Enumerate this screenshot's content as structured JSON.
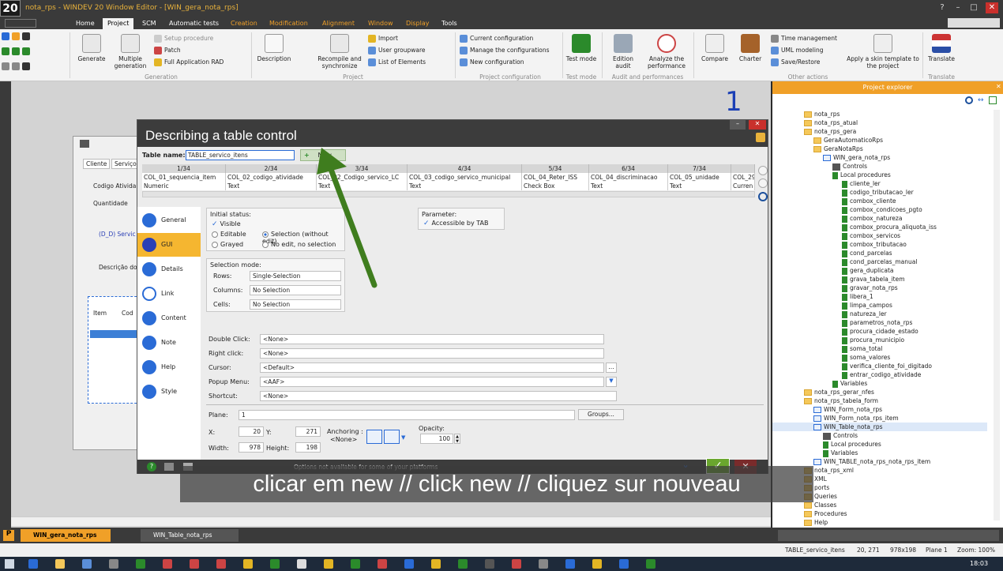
{
  "window": {
    "logo": "20",
    "title": "nota_rps - WINDEV 20  Window Editor - [WIN_gera_nota_rps]"
  },
  "menu": [
    "Home",
    "Project",
    "SCM",
    "Automatic tests",
    "Creation",
    "Modification",
    "Alignment",
    "Window",
    "Display",
    "Tools"
  ],
  "ribbon": {
    "generation": {
      "label": "Generation",
      "generate": "Generate",
      "multiple": "Multiple generation",
      "setup": "Setup procedure",
      "patch": "Patch",
      "full": "Full Application RAD"
    },
    "project": {
      "label": "Project",
      "description": "Description",
      "recompile": "Recompile and synchronize",
      "import": "Import",
      "user_groupware": "User groupware",
      "list_elements": "List of Elements"
    },
    "config": {
      "label": "Project configuration",
      "current": "Current configuration",
      "manage": "Manage the configurations",
      "new": "New configuration"
    },
    "testmode": {
      "label": "Test mode",
      "btn": "Test mode"
    },
    "audit": {
      "label": "Audit and performances",
      "edition": "Edition audit",
      "analyze": "Analyze the performance"
    },
    "other": {
      "label": "Other actions",
      "compare": "Compare",
      "charter": "Charter",
      "time": "Time management",
      "uml": "UML modeling",
      "saverestore": "Save/Restore",
      "skin": "Apply a skin template to the project"
    },
    "translate": {
      "label": "Translate",
      "btn": "Translate"
    }
  },
  "annotation_number": "1",
  "bg_window": {
    "tabs": [
      "Cliente",
      "Serviços"
    ],
    "labels": [
      "Codigo Ativida",
      "Quantidade",
      "(D_D) Servic",
      "Descrição do"
    ],
    "cols": [
      "Item",
      "Cod"
    ]
  },
  "dialog": {
    "title": "Describing a table control",
    "table_name_label": "Table name:",
    "table_name_value": "TABLE_servico_itens",
    "new_button": "New",
    "columns": [
      {
        "idx": "1/34",
        "name": "COL_01_sequencia_item",
        "type": "Numeric"
      },
      {
        "idx": "2/34",
        "name": "COL_02_codigo_atividade",
        "type": "Text"
      },
      {
        "idx": "3/34",
        "name": "COL_02_Codigo_servico_LC",
        "type": "Text"
      },
      {
        "idx": "4/34",
        "name": "COL_03_codigo_servico_municipal",
        "type": "Text"
      },
      {
        "idx": "5/34",
        "name": "COL_04_Reter_ISS",
        "type": "Check Box"
      },
      {
        "idx": "6/34",
        "name": "COL_04_discriminacao",
        "type": "Text"
      },
      {
        "idx": "7/34",
        "name": "COL_05_unidade",
        "type": "Text"
      },
      {
        "idx": "",
        "name": "COL_29",
        "type": "Curren"
      }
    ],
    "tabs": [
      "General",
      "GUI",
      "Details",
      "Link",
      "Content",
      "Note",
      "Help",
      "Style"
    ],
    "initial_status": {
      "label": "Initial status:",
      "visible": "Visible",
      "editable": "Editable",
      "grayed": "Grayed",
      "selection": "Selection (without edit)",
      "noedit": "No edit, no selection"
    },
    "parameter": {
      "label": "Parameter:",
      "accessible": "Accessible by TAB"
    },
    "selection_mode": {
      "label": "Selection mode:",
      "rows_label": "Rows:",
      "rows": "Single-Selection",
      "columns_label": "Columns:",
      "columns": "No Selection",
      "cells_label": "Cells:",
      "cells": "No Selection"
    },
    "fields": [
      {
        "label": "Double Click:",
        "value": "<None>"
      },
      {
        "label": "Right click:",
        "value": "<None>"
      },
      {
        "label": "Cursor:",
        "value": "<Default>"
      },
      {
        "label": "Popup Menu:",
        "value": "<AAF>"
      },
      {
        "label": "Shortcut:",
        "value": "<None>"
      }
    ],
    "plane": {
      "label": "Plane:",
      "value": "1",
      "groups": "Groups..."
    },
    "geometry": {
      "x_label": "X:",
      "x": "20",
      "y_label": "Y:",
      "y": "271",
      "w_label": "Width:",
      "w": "978",
      "h_label": "Height:",
      "h": "198",
      "anchor_label": "Anchoring :",
      "anchor": "<None>",
      "opacity_label": "Opacity:",
      "opacity": "100"
    },
    "footer_msg": "Options not available for some of your platforms"
  },
  "caption": "clicar em new // click new // cliquez sur nouveau",
  "explorer": {
    "title": "Project explorer",
    "items": [
      {
        "t": "nota_rps",
        "k": "fold",
        "d": 0
      },
      {
        "t": "nota_rps_atual",
        "k": "fold",
        "d": 0
      },
      {
        "t": "nota_rps_gera",
        "k": "fold",
        "d": 0
      },
      {
        "t": "GeraAutomaticoRps",
        "k": "fold",
        "d": 1
      },
      {
        "t": "GeraNotaRps",
        "k": "fold",
        "d": 1
      },
      {
        "t": "WIN_gera_nota_rps",
        "k": "win",
        "d": 2
      },
      {
        "t": "Controls",
        "k": "tag",
        "d": 3
      },
      {
        "t": "Local procedures",
        "k": "code",
        "d": 3
      },
      {
        "t": "cliente_ler",
        "k": "code",
        "d": 4
      },
      {
        "t": "codigo_tributacao_ler",
        "k": "code",
        "d": 4
      },
      {
        "t": "combox_cliente",
        "k": "code",
        "d": 4
      },
      {
        "t": "combox_condicoes_pgto",
        "k": "code",
        "d": 4
      },
      {
        "t": "combox_natureza",
        "k": "code",
        "d": 4
      },
      {
        "t": "combox_procura_aliquota_iss",
        "k": "code",
        "d": 4
      },
      {
        "t": "combox_servicos",
        "k": "code",
        "d": 4
      },
      {
        "t": "combox_tributacao",
        "k": "code",
        "d": 4
      },
      {
        "t": "cond_parcelas",
        "k": "code",
        "d": 4
      },
      {
        "t": "cond_parcelas_manual",
        "k": "code",
        "d": 4
      },
      {
        "t": "gera_duplicata",
        "k": "code",
        "d": 4
      },
      {
        "t": "grava_tabela_item",
        "k": "code",
        "d": 4
      },
      {
        "t": "gravar_nota_rps",
        "k": "code",
        "d": 4
      },
      {
        "t": "libera_1",
        "k": "code",
        "d": 4
      },
      {
        "t": "limpa_campos",
        "k": "code",
        "d": 4
      },
      {
        "t": "natureza_ler",
        "k": "code",
        "d": 4
      },
      {
        "t": "parametros_nota_rps",
        "k": "code",
        "d": 4
      },
      {
        "t": "procura_cidade_estado",
        "k": "code",
        "d": 4
      },
      {
        "t": "procura_municipio",
        "k": "code",
        "d": 4
      },
      {
        "t": "soma_total",
        "k": "code",
        "d": 4
      },
      {
        "t": "soma_valores",
        "k": "code",
        "d": 4
      },
      {
        "t": "verifica_cliente_foi_digitado",
        "k": "code",
        "d": 4
      },
      {
        "t": "entrar_codigo_atividade",
        "k": "code",
        "d": 4
      },
      {
        "t": "Variables",
        "k": "code",
        "d": 3
      },
      {
        "t": "nota_rps_gerar_nfes",
        "k": "fold",
        "d": 0
      },
      {
        "t": "nota_rps_tabela_form",
        "k": "fold",
        "d": 0
      },
      {
        "t": "WIN_Form_nota_rps",
        "k": "win",
        "d": 1
      },
      {
        "t": "WIN_Form_nota_rps_item",
        "k": "win",
        "d": 1
      },
      {
        "t": "WIN_Table_nota_rps",
        "k": "win",
        "d": 1
      },
      {
        "t": "Controls",
        "k": "tag",
        "d": 2
      },
      {
        "t": "Local procedures",
        "k": "code",
        "d": 2
      },
      {
        "t": "Variables",
        "k": "code",
        "d": 2
      },
      {
        "t": "WIN_TABLE_nota_rps_nota_rps_item",
        "k": "win",
        "d": 1
      },
      {
        "t": "nota_rps_xml",
        "k": "fold",
        "d": 0
      },
      {
        "t": "XML",
        "k": "fold",
        "d": -1
      },
      {
        "t": "ports",
        "k": "fold",
        "d": -1
      },
      {
        "t": "Queries",
        "k": "fold",
        "d": -1
      },
      {
        "t": "Classes",
        "k": "fold",
        "d": -1
      },
      {
        "t": "Procedures",
        "k": "fold",
        "d": -1
      },
      {
        "t": "Help",
        "k": "fold",
        "d": -1
      }
    ]
  },
  "doc_tabs": [
    "WIN_gera_nota_rps",
    "WIN_Table_nota_rps"
  ],
  "status": {
    "control": "TABLE_servico_itens",
    "pos": "20, 271",
    "size": "978x198",
    "plane": "Plane 1",
    "zoom": "Zoom: 100%"
  },
  "clock": "18:03",
  "colors": {
    "accent": "#f0a028",
    "dark": "#3a3a3a",
    "selection": "#2a6bd6",
    "arrow": "#3f7d1e"
  }
}
